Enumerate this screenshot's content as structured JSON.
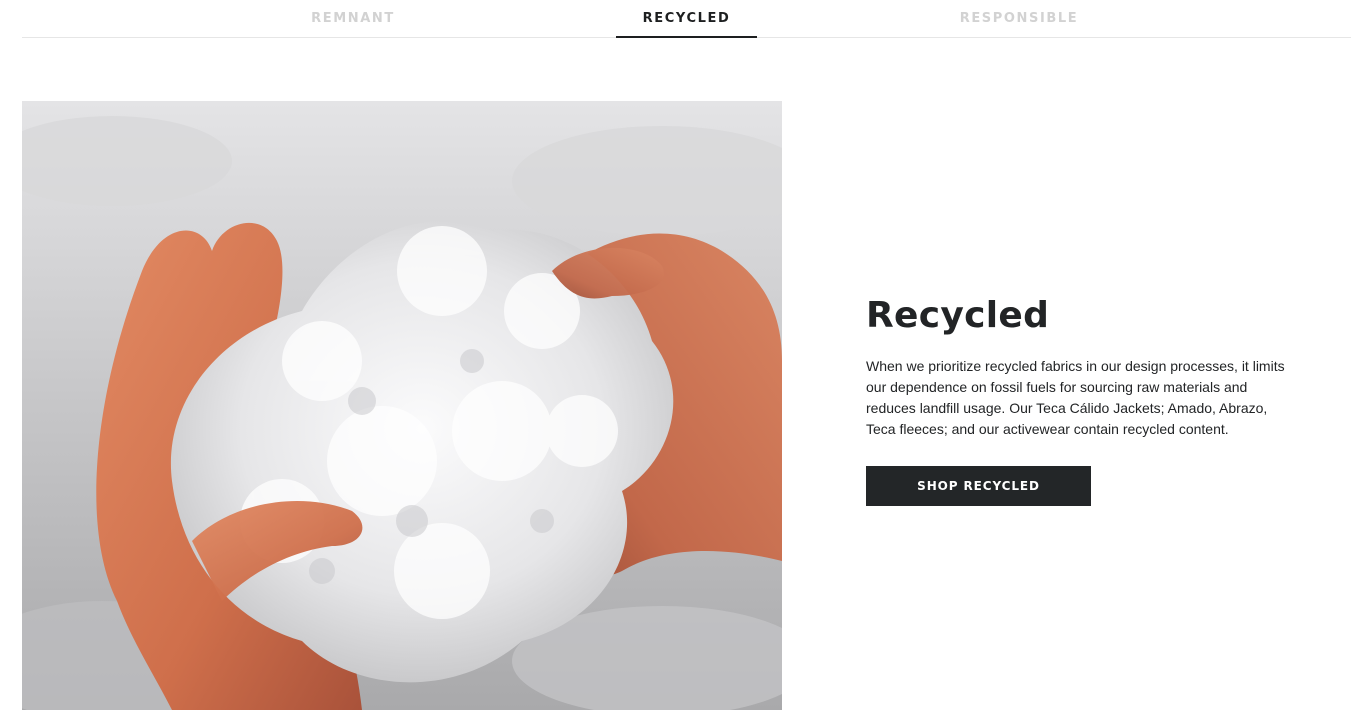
{
  "tabs": [
    {
      "label": "REMNANT",
      "active": false
    },
    {
      "label": "RECYCLED",
      "active": true
    },
    {
      "label": "RESPONSIBLE",
      "active": false
    }
  ],
  "hero_image": {
    "icon": "photo-hands-holding-recycled-fiber"
  },
  "section": {
    "heading": "Recycled",
    "description": "When we prioritize recycled fabrics in our design processes, it limits our dependence on fossil fuels for sourcing raw materials and reduces landfill usage. Our Teca Cálido Jackets; Amado, Abrazo, Teca fleeces; and our activewear contain recycled content.",
    "cta_label": "SHOP RECYCLED"
  },
  "colors": {
    "text": "#222426",
    "inactive_tab": "#d2d2d2",
    "button_bg": "#232628",
    "divider": "#e6e6e6"
  }
}
